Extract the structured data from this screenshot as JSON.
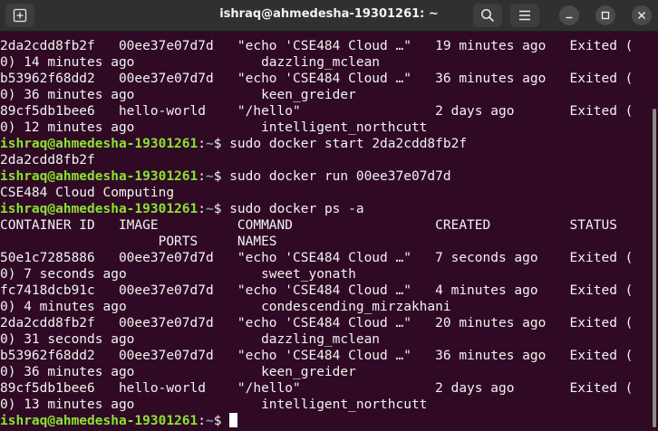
{
  "window": {
    "title": "ishraq@ahmedesha-19301261: ~"
  },
  "prompt": {
    "user_host": "ishraq@ahmedesha-19301261",
    "sep": ":",
    "path": "~",
    "dollar": "$ "
  },
  "lines": [
    {
      "text": "2da2cdd8fb2f   00ee37e07d7d   \"echo 'CSE484 Cloud …\"   19 minutes ago   Exited ("
    },
    {
      "text": "0) 14 minutes ago                dazzling_mclean"
    },
    {
      "text": "b53962f68dd2   00ee37e07d7d   \"echo 'CSE484 Cloud …\"   36 minutes ago   Exited ("
    },
    {
      "text": "0) 36 minutes ago                keen_greider"
    },
    {
      "text": "89cf5db1bee6   hello-world    \"/hello\"                 2 days ago       Exited ("
    },
    {
      "text": "0) 12 minutes ago                intelligent_northcutt"
    },
    {
      "cmd": "sudo docker start 2da2cdd8fb2f"
    },
    {
      "text": "2da2cdd8fb2f"
    },
    {
      "cmd": "sudo docker run 00ee37e07d7d"
    },
    {
      "text": "CSE484 Cloud Computing"
    },
    {
      "cmd": "sudo docker ps -a"
    },
    {
      "text": "CONTAINER ID   IMAGE          COMMAND                  CREATED          STATUS"
    },
    {
      "text": "                    PORTS     NAMES"
    },
    {
      "text": "50e1c7285886   00ee37e07d7d   \"echo 'CSE484 Cloud …\"   7 seconds ago    Exited ("
    },
    {
      "text": "0) 7 seconds ago                 sweet_yonath"
    },
    {
      "text": "fc7418dcb91c   00ee37e07d7d   \"echo 'CSE484 Cloud …\"   4 minutes ago    Exited ("
    },
    {
      "text": "0) 4 minutes ago                 condescending_mirzakhani"
    },
    {
      "text": "2da2cdd8fb2f   00ee37e07d7d   \"echo 'CSE484 Cloud …\"   20 minutes ago   Exited ("
    },
    {
      "text": "0) 31 seconds ago                dazzling_mclean"
    },
    {
      "text": "b53962f68dd2   00ee37e07d7d   \"echo 'CSE484 Cloud …\"   36 minutes ago   Exited ("
    },
    {
      "text": "0) 36 minutes ago                keen_greider"
    },
    {
      "text": "89cf5db1bee6   hello-world    \"/hello\"                 2 days ago       Exited ("
    },
    {
      "text": "0) 13 minutes ago                intelligent_northcutt"
    },
    {
      "cmd": "",
      "cursor": true
    }
  ]
}
